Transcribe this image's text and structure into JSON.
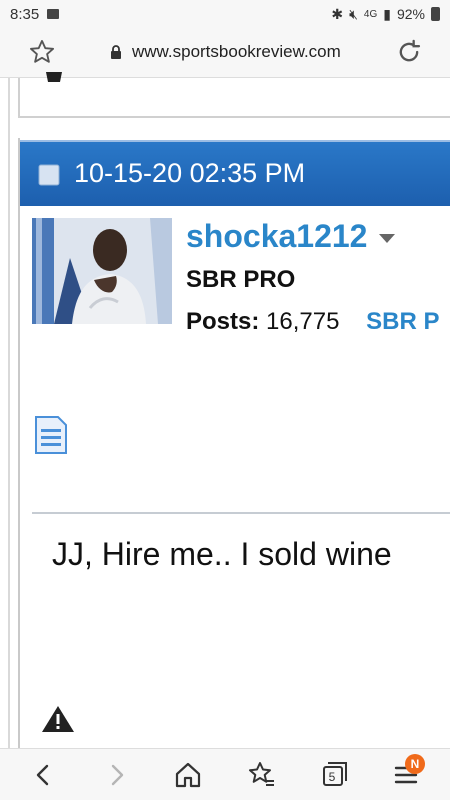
{
  "status_bar": {
    "time": "8:35",
    "network": "4G",
    "battery": "92%"
  },
  "browser": {
    "url": "www.sportsbookreview.com"
  },
  "post": {
    "date": "10-15-20 02:35 PM",
    "username": "shocka1212",
    "rank": "SBR PRO",
    "posts_label": "Posts:",
    "posts_count": "16,775",
    "sbr_label": "SBR P",
    "message": "JJ, Hire me.. I sold wine"
  },
  "bottom_nav": {
    "tab_count": "5",
    "notification_badge": "N"
  },
  "colors": {
    "header_blue": "#1d5fae",
    "link_blue": "#2a86c9",
    "badge_orange": "#f06a1a"
  },
  "icons": [
    "star-icon",
    "lock-icon",
    "reload-icon",
    "document-icon",
    "page-icon",
    "warning-icon",
    "back-icon",
    "forward-icon",
    "home-icon",
    "bookmarks-icon",
    "tabs-icon",
    "menu-icon"
  ]
}
